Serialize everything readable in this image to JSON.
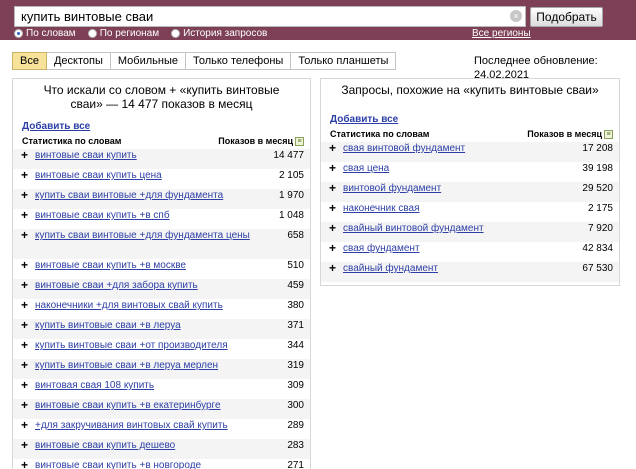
{
  "search": {
    "query": "купить винтовые сваи",
    "clear_icon": "×",
    "submit_label": "Подобрать",
    "modes": [
      {
        "label": "По словам",
        "checked": true
      },
      {
        "label": "По регионам",
        "checked": false
      },
      {
        "label": "История запросов",
        "checked": false
      }
    ],
    "all_regions_label": "Все регионы"
  },
  "device_tabs": [
    {
      "label": "Все",
      "active": true
    },
    {
      "label": "Десктопы",
      "active": false
    },
    {
      "label": "Мобильные",
      "active": false
    },
    {
      "label": "Только телефоны",
      "active": false
    },
    {
      "label": "Только планшеты",
      "active": false
    }
  ],
  "last_update": "Последнее обновление: 24.02.2021",
  "left_panel": {
    "title_line1": "Что искали со словом  +  «купить винтовые",
    "title_line2": "сваи» — 14 477 показов в месяц",
    "add_all": "Добавить все",
    "col_phrase": "Статистика по словам",
    "col_shows": "Показов в месяц",
    "sort_icon": "≡",
    "rows": [
      {
        "plus": "+",
        "phrase": "винтовые сваи купить",
        "count": "14 477"
      },
      {
        "plus": "+",
        "phrase": "винтовые сваи купить цена",
        "count": "2 105"
      },
      {
        "plus": "+",
        "phrase": "купить сваи винтовые +для фундамента",
        "count": "1 970"
      },
      {
        "plus": "+",
        "phrase": "винтовые сваи купить +в спб",
        "count": "1 048"
      },
      {
        "plus": "+",
        "phrase": "купить сваи винтовые +для фундамента цены",
        "count": "658"
      },
      {
        "plus": "+",
        "phrase": "винтовые сваи купить +в москве",
        "count": "510"
      },
      {
        "plus": "+",
        "phrase": "винтовые сваи +для забора купить",
        "count": "459"
      },
      {
        "plus": "+",
        "phrase": "наконечники +для винтовых свай купить",
        "count": "380"
      },
      {
        "plus": "+",
        "phrase": "купить винтовые сваи +в леруа",
        "count": "371"
      },
      {
        "plus": "+",
        "phrase": "купить винтовые сваи +от производителя",
        "count": "344"
      },
      {
        "plus": "+",
        "phrase": "купить винтовые сваи +в леруа мерлен",
        "count": "319"
      },
      {
        "plus": "+",
        "phrase": "винтовая свая 108 купить",
        "count": "309"
      },
      {
        "plus": "+",
        "phrase": "винтовые сваи купить +в екатеринбурге",
        "count": "300"
      },
      {
        "plus": "+",
        "phrase": "+для закручивания винтовых свай купить",
        "count": "289"
      },
      {
        "plus": "+",
        "phrase": "винтовые сваи купить дешево",
        "count": "283"
      },
      {
        "plus": "+",
        "phrase": "винтовые сваи купить +в новгороде",
        "count": "271"
      }
    ]
  },
  "right_panel": {
    "title": "Запросы, похожие на «купить винтовые сваи»",
    "add_all": "Добавить все",
    "col_phrase": "Статистика по словам",
    "col_shows": "Показов в месяц",
    "sort_icon": "≡",
    "rows": [
      {
        "plus": "+",
        "phrase": "свая винтовой фундамент",
        "count": "17 208"
      },
      {
        "plus": "+",
        "phrase": "свая цена",
        "count": "39 198"
      },
      {
        "plus": "+",
        "phrase": "винтовой фундамент",
        "count": "29 520"
      },
      {
        "plus": "+",
        "phrase": "наконечник свая",
        "count": "2 175"
      },
      {
        "plus": "+",
        "phrase": "свайный винтовой фундамент",
        "count": "7 920"
      },
      {
        "plus": "+",
        "phrase": "свая фундамент",
        "count": "42 834"
      },
      {
        "plus": "+",
        "phrase": "свайный фундамент",
        "count": "67 530"
      }
    ]
  },
  "colors": {
    "header": "#7d4056",
    "link": "#2d3fa6",
    "active_tab": "#f7e29a"
  }
}
